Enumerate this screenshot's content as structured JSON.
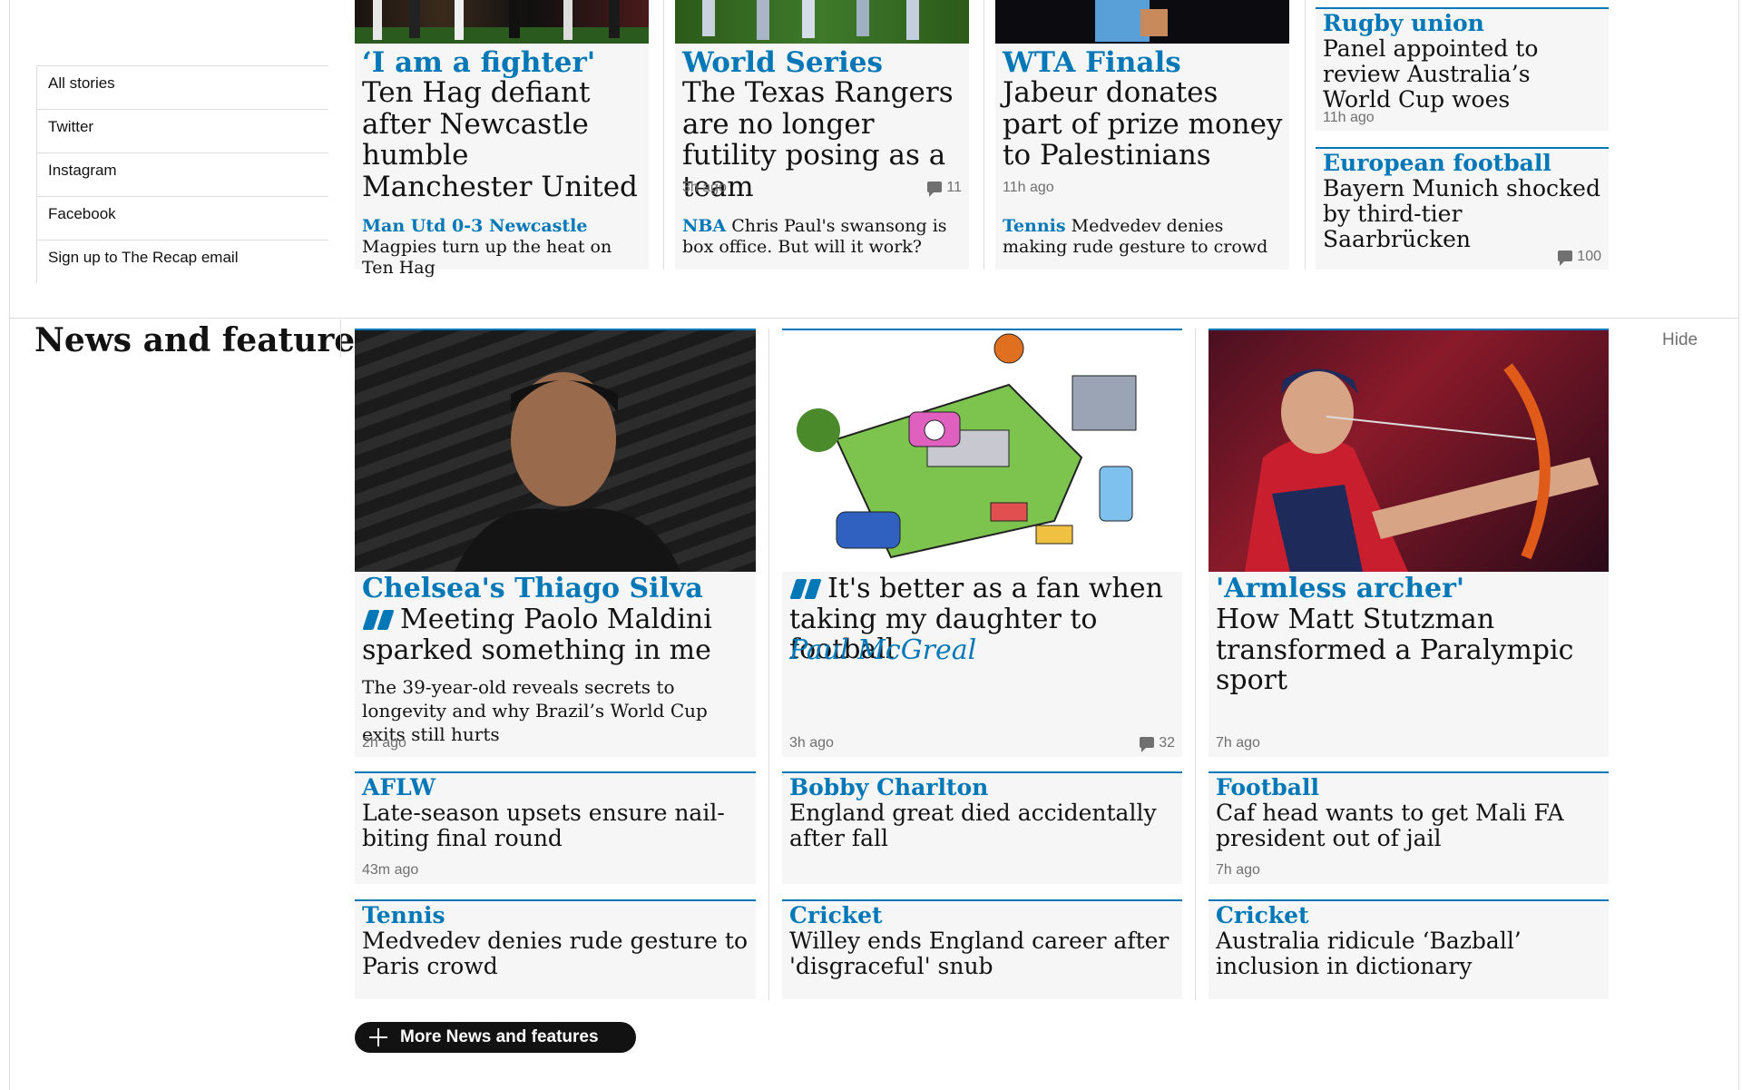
{
  "side_links": [
    "All stories",
    "Twitter",
    "Instagram",
    "Facebook",
    "Sign up to The Recap email"
  ],
  "top_cards": [
    {
      "kicker": "‘I am a fighter'",
      "headline": "Ten Hag defiant after Newcastle humble Manchester United",
      "sub_kicker": "Man Utd 0-3 Newcastle",
      "sub_text": "Magpies turn up the heat on Ten Hag"
    },
    {
      "kicker": "World Series",
      "headline": "The Texas Rangers are no longer futility posing as a team",
      "time": "3h ago",
      "comments": "11",
      "sub_kicker": "NBA",
      "sub_text": "Chris Paul's swansong is box office. But will it work?"
    },
    {
      "kicker": "WTA Finals",
      "headline": "Jabeur donates part of prize money to Palestinians",
      "time": "11h ago",
      "sub_kicker": "Tennis",
      "sub_text": "Medvedev denies making rude gesture to crowd"
    }
  ],
  "right_cards": [
    {
      "kicker": "Rugby union",
      "headline": "Panel appointed to review Australia’s World Cup woes",
      "time": "11h ago"
    },
    {
      "kicker": "European football",
      "headline": "Bayern Munich shocked by third-tier Saarbrücken",
      "comments": "100"
    }
  ],
  "section": {
    "title": "News and features",
    "hide_label": "Hide",
    "more_label": "More News and features"
  },
  "features": [
    {
      "kicker": "Chelsea's Thiago Silva",
      "headline": "Meeting Paolo Maldini sparked something in me",
      "standfirst": "The 39-year-old reveals secrets to longevity and why Brazil’s World Cup exits still hurts",
      "time": "2h ago"
    },
    {
      "headline": "It's better as a fan when taking my daughter to football",
      "byline": "Paul McGreal",
      "time": "3h ago",
      "comments": "32"
    },
    {
      "kicker": "'Armless archer'",
      "headline": "How Matt Stutzman transformed a Paralympic sport",
      "time": "7h ago"
    }
  ],
  "small_cards_row1": [
    {
      "kicker": "AFLW",
      "headline": "Late-season upsets ensure nail-biting final round",
      "time": "43m ago"
    },
    {
      "kicker": "Bobby Charlton",
      "headline": "England great died accidentally after fall"
    },
    {
      "kicker": "Football",
      "headline": "Caf head wants to get Mali FA president out of jail",
      "time": "7h ago"
    }
  ],
  "small_cards_row2": [
    {
      "kicker": "Tennis",
      "headline": "Medvedev denies rude gesture to Paris crowd"
    },
    {
      "kicker": "Cricket",
      "headline": "Willey ends England career after 'disgraceful' snub"
    },
    {
      "kicker": "Cricket",
      "headline": "Australia ridicule ‘Bazball’ inclusion in dictionary"
    }
  ],
  "colors": {
    "accent": "#0077b6",
    "card_bg": "#f6f6f6",
    "text": "#121212",
    "meta": "#707070"
  }
}
